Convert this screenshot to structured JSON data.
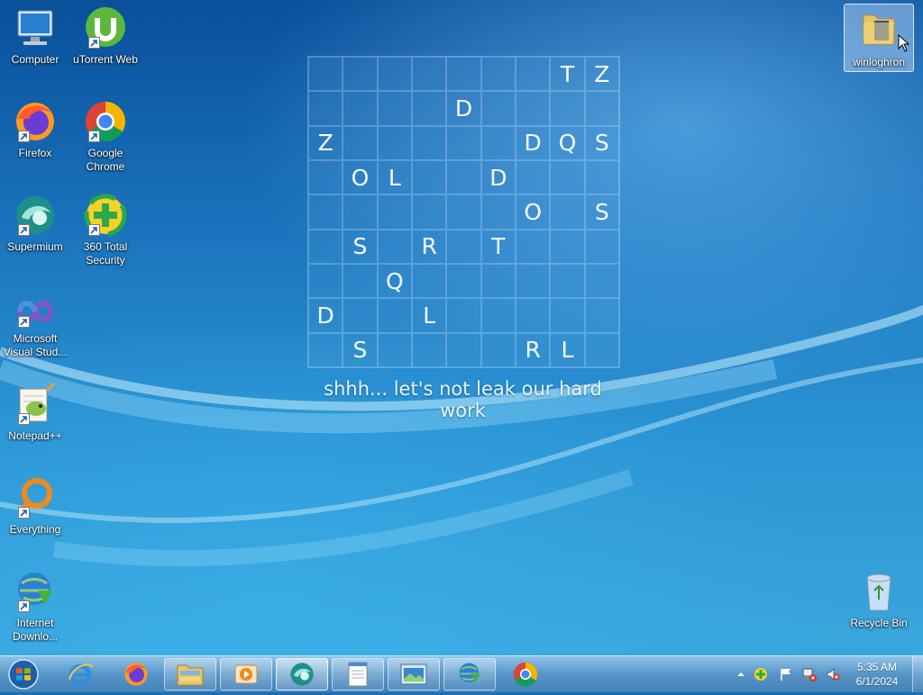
{
  "desktop_icons": {
    "computer": "Computer",
    "utorrent": "uTorrent Web",
    "firefox": "Firefox",
    "chrome": "Google Chrome",
    "supermium": "Supermium",
    "security360": "360 Total Security",
    "visual_studio": "Microsoft Visual Stud...",
    "notepadpp": "Notepad++",
    "everything": "Everything",
    "idm": "Internet Downlo...",
    "winloghron": "winloghron",
    "recycle_bin": "Recycle Bin"
  },
  "wallpaper": {
    "grid_rows": [
      [
        "",
        "",
        "",
        "",
        "",
        "",
        "",
        "T",
        "Z"
      ],
      [
        "",
        "",
        "",
        "",
        "D",
        "",
        "",
        "",
        ""
      ],
      [
        "Z",
        "",
        "",
        "",
        "",
        "",
        "D",
        "Q",
        "S"
      ],
      [
        "",
        "O",
        "L",
        "",
        "",
        "D",
        "",
        "",
        ""
      ],
      [
        "",
        "",
        "",
        "",
        "",
        "",
        "O",
        "",
        "S"
      ],
      [
        "",
        "S",
        "",
        "R",
        "",
        "T",
        "",
        "",
        ""
      ],
      [
        "",
        "",
        "Q",
        "",
        "",
        "",
        "",
        "",
        ""
      ],
      [
        "D",
        "",
        "",
        "L",
        "",
        "",
        "",
        "",
        ""
      ],
      [
        "",
        "S",
        "",
        "",
        "",
        "",
        "R",
        "L",
        ""
      ]
    ],
    "tagline": "shhh... let's not leak our hard work"
  },
  "taskbar": {
    "pinned": [
      {
        "name": "internet-explorer",
        "icon": "ie-icon"
      },
      {
        "name": "firefox",
        "icon": "firefox-icon"
      },
      {
        "name": "windows-explorer",
        "icon": "folder-icon"
      },
      {
        "name": "media-player",
        "icon": "media-player-icon"
      },
      {
        "name": "supermium",
        "icon": "supermium-icon"
      },
      {
        "name": "notepad",
        "icon": "notepad-icon"
      },
      {
        "name": "screen-app",
        "icon": "window-icon"
      },
      {
        "name": "internet-download-manager",
        "icon": "idm-icon"
      },
      {
        "name": "google-chrome",
        "icon": "chrome-icon"
      }
    ],
    "clock": {
      "time": "5:35 AM",
      "date": "6/1/2024"
    }
  },
  "colors": {
    "accent": "#1a74bd",
    "grid_text": "#f4fbff"
  }
}
